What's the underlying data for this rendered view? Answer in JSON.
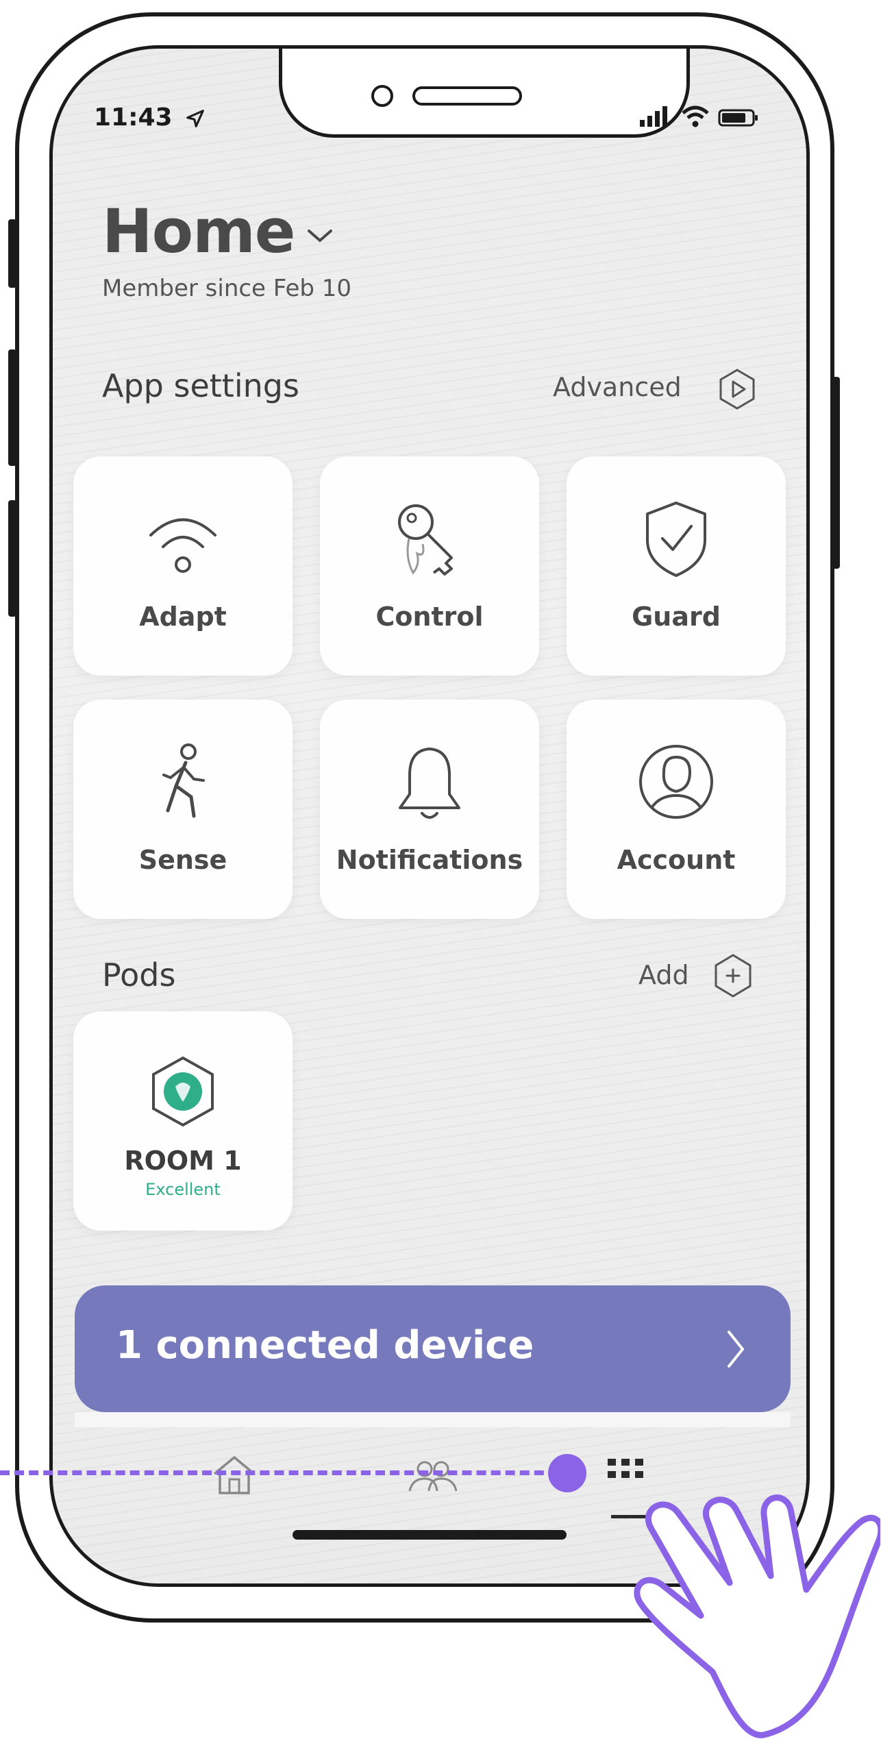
{
  "status_bar": {
    "time": "11:43"
  },
  "header": {
    "title": "Home",
    "subtitle": "Member since Feb 10"
  },
  "app_settings": {
    "heading": "App settings",
    "advanced_label": "Advanced",
    "tiles": [
      {
        "label": "Adapt",
        "icon": "wifi-icon"
      },
      {
        "label": "Control",
        "icon": "keys-icon"
      },
      {
        "label": "Guard",
        "icon": "shield-check-icon"
      },
      {
        "label": "Sense",
        "icon": "walking-person-icon"
      },
      {
        "label": "Notifications",
        "icon": "bell-icon"
      },
      {
        "label": "Account",
        "icon": "user-avatar-icon"
      }
    ]
  },
  "pods": {
    "heading": "Pods",
    "add_label": "Add",
    "items": [
      {
        "name": "ROOM 1",
        "status": "Excellent"
      }
    ]
  },
  "banner": {
    "label": "1 connected device"
  },
  "bottom_nav": {
    "items": [
      {
        "icon": "home-icon"
      },
      {
        "icon": "people-icon"
      },
      {
        "icon": "grid-icon",
        "active": true
      }
    ]
  },
  "colors": {
    "accent": "#7679bb",
    "pod_status": "#2fae8a",
    "annotation": "#8a63e6"
  }
}
